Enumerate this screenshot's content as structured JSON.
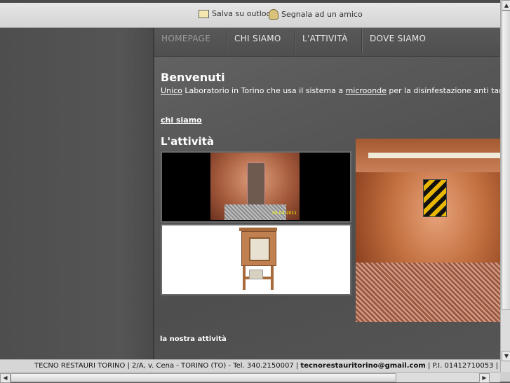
{
  "topbar": {
    "save_outlook": "Salva su outlook",
    "report_friend": "Segnala ad un amico"
  },
  "nav": [
    {
      "label": "HOMEPAGE",
      "active": true
    },
    {
      "label": "CHI SIAMO",
      "active": false
    },
    {
      "label": "L'ATTIVITÀ",
      "active": false
    },
    {
      "label": "DOVE SIAMO",
      "active": false
    }
  ],
  "welcome": {
    "title": "Benvenuti",
    "link1": "Unico",
    "text1": " Laboratorio in Torino che usa il sistema a ",
    "link2": "microonde",
    "text2": " per la disinfestazione anti tarlo/tarme e"
  },
  "chi_siamo_link": "chi siamo",
  "attivita_title": "L'attività",
  "image_stamp": "05-03-2011",
  "nostra_attivita_link": "la nostra attività",
  "footer": {
    "text1": "TECNO RESTAURI TORINO | 2/A, v. Cena - TORINO (TO) - Tel. 340.2150007 | ",
    "email": "tecnorestauritorino@gmail.com",
    "text2": " | P.I. 01412710053 |"
  }
}
